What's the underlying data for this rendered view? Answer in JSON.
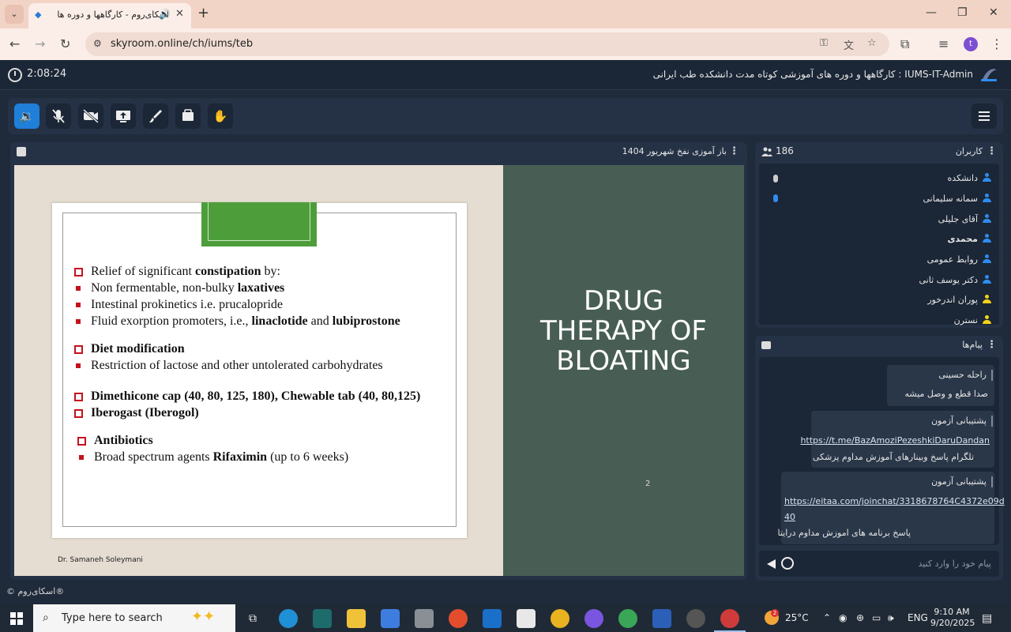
{
  "browser": {
    "tab_title": "اسکای‌روم - کارگاهها و دوره ها",
    "url": "skyroom.online/ch/iums/teb",
    "profile_initial": "t"
  },
  "header": {
    "timer": "2:08:24",
    "room_title": "IUMS-IT-Admin : کارگاهها و دوره های آموزشی کوتاه مدت دانشکده طب ایرانی"
  },
  "presentation": {
    "title": "باز آموزی نفخ شهریور 1404",
    "slide": {
      "big_title_lines": [
        "DRUG",
        "THERAPY OF",
        "BLOATING"
      ],
      "page_number": "2",
      "author": "Dr. Samaneh Soleymani",
      "bullets": {
        "b1_pre": "Relief of significant ",
        "b1_bold": "constipation",
        "b1_post": " by:",
        "b2_pre": "Non fermentable, non-bulky ",
        "b2_bold": "laxatives",
        "b3": "Intestinal prokinetics i.e. prucalopride",
        "b4_pre": "Fluid exorption promoters, i.e., ",
        "b4_bold1": "linaclotide",
        "b4_mid": " and ",
        "b4_bold2": "lubiprostone",
        "b5": "Diet modification",
        "b6": "Restriction of lactose and other untolerated carbohydrates",
        "b7": "Dimethicone cap (40, 80, 125, 180), Chewable tab (40, 80,125)",
        "b8": "Iberogast (Iberogol)",
        "b9": "Antibiotics",
        "b10_pre": "Broad spectrum agents ",
        "b10_bold": "Rifaximin",
        "b10_post": " (up to 6 weeks)"
      }
    }
  },
  "users": {
    "title": "کاربران",
    "count": "186",
    "list": [
      {
        "name": "دانشکده",
        "color": "#2f8cf0"
      },
      {
        "name": "سمانه سلیمانی",
        "color": "#2f8cf0"
      },
      {
        "name": "آقای جلیلی",
        "color": "#2f8cf0"
      },
      {
        "name": "محمدی",
        "color": "#2f8cf0"
      },
      {
        "name": "روابط عمومی",
        "color": "#2f8cf0"
      },
      {
        "name": "دکتر یوسف ثانی",
        "color": "#2f8cf0"
      },
      {
        "name": "پوران اندرخور",
        "color": "#f2d21b"
      },
      {
        "name": "نسترن",
        "color": "#f2d21b"
      }
    ]
  },
  "chat": {
    "title": "پیام‌ها",
    "messages": [
      {
        "sender": "راحله حسینی",
        "text": "صدا قطع و وصل میشه"
      },
      {
        "sender": "پشتیبانی آزمون",
        "link": "https://t.me/BazAmoziPezeshkiDaruDandan",
        "text": "تلگرام پاسخ وبینارهای آموزش مداوم پزشکی"
      },
      {
        "sender": "پشتیبانی آزمون",
        "link1": "https://eitaa.com/joinchat/3318678764C4372e09d",
        "link2": "40",
        "text": "پاسخ برنامه های اموزش مداوم درایتا"
      }
    ],
    "input_placeholder": "پیام خود را وارد کنید"
  },
  "footer": {
    "brand": "© اسکای‌روم®"
  },
  "taskbar": {
    "search_placeholder": "Type here to search",
    "temperature": "25°C",
    "weather_badge": "2",
    "language": "ENG",
    "time": "9:10 AM",
    "date": "9/20/2025"
  }
}
